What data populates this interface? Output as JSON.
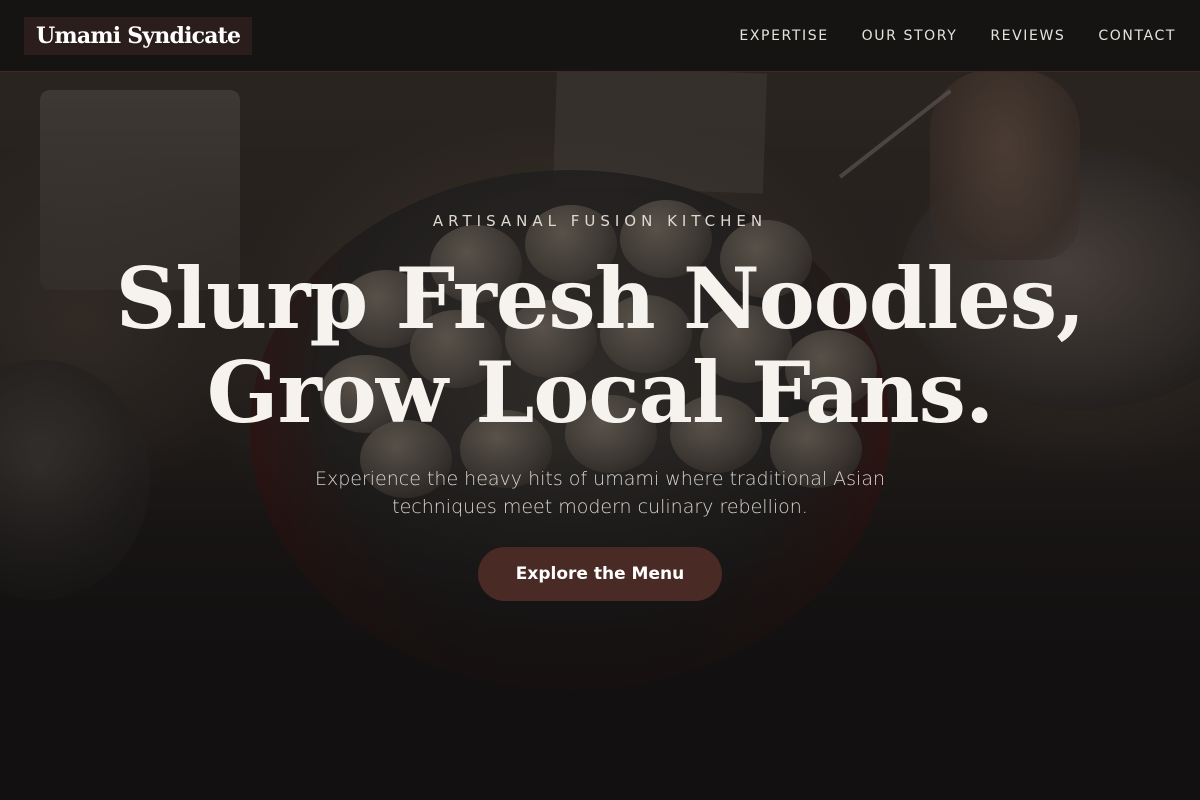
{
  "header": {
    "logo": "Umami Syndicate",
    "nav": [
      {
        "label": "EXPERTISE"
      },
      {
        "label": "OUR STORY"
      },
      {
        "label": "REVIEWS"
      },
      {
        "label": "CONTACT"
      }
    ]
  },
  "hero": {
    "eyebrow": "ARTISANAL FUSION KITCHEN",
    "headline_line1": "Slurp Fresh Noodles,",
    "headline_line2": "Grow Local Fans.",
    "subtext": "Experience the heavy hits of umami where traditional Asian techniques meet modern culinary rebellion.",
    "cta_label": "Explore the Menu",
    "background_image": "takoyaki-pan-photo"
  },
  "colors": {
    "accent": "#4a2a25",
    "header_bg": "#141212",
    "text": "#f6f3ee"
  }
}
